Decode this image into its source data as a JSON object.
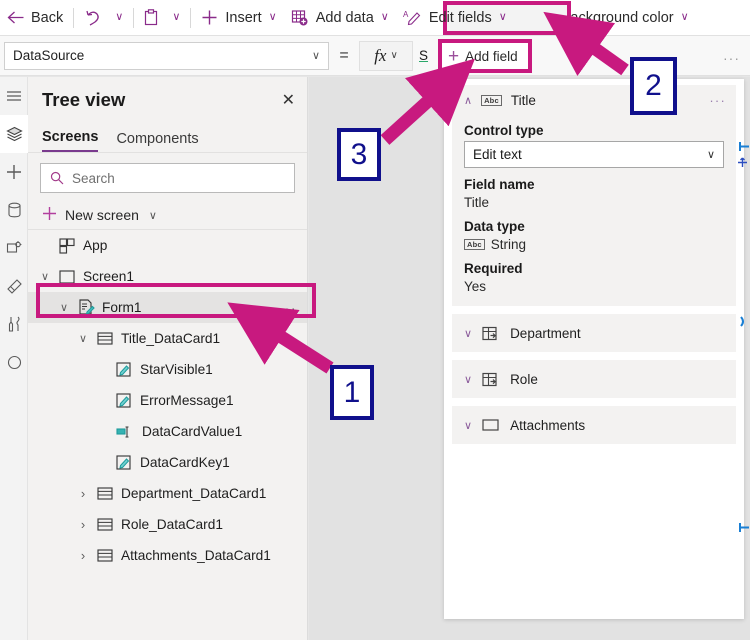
{
  "toolbar": {
    "back_label": "Back",
    "undo_icon": "undo-icon",
    "undo_chevron": "∨",
    "paste_icon": "paste-icon",
    "paste_chevron": "∨",
    "insert_label": "Insert",
    "insert_chevron": "∨",
    "add_data_label": "Add data",
    "add_data_chevron": "∨",
    "edit_fields_label": "Edit fields",
    "edit_fields_chevron": "∨",
    "background_color_label": "Background color",
    "background_color_chevron": "∨"
  },
  "formula_bar": {
    "property_value": "DataSource",
    "property_chevron": "∨",
    "equals": "=",
    "fx_label": "fx",
    "fx_chevron": "∨",
    "formula_text": "S",
    "overflow_dots": "···",
    "add_field_label": "Add field",
    "add_field_plus": "+"
  },
  "tree_view": {
    "title": "Tree view",
    "close_label": "✕",
    "tabs": [
      {
        "label": "Screens",
        "selected": true
      },
      {
        "label": "Components",
        "selected": false
      }
    ],
    "search_placeholder": "Search",
    "new_screen_label": "New screen",
    "new_screen_chevron": "∨",
    "nodes": [
      {
        "label": "App",
        "indent": 0,
        "twisty": "",
        "icon": "app-icon",
        "selected": false,
        "dots": false
      },
      {
        "label": "Screen1",
        "indent": 0,
        "twisty": "∨",
        "icon": "screen-icon",
        "selected": false,
        "dots": false
      },
      {
        "label": "Form1",
        "indent": 1,
        "twisty": "∨",
        "icon": "form-icon",
        "selected": true,
        "dots": true
      },
      {
        "label": "Title_DataCard1",
        "indent": 2,
        "twisty": "∨",
        "icon": "datacard-icon",
        "selected": false,
        "dots": false
      },
      {
        "label": "StarVisible1",
        "indent": 3,
        "twisty": "",
        "icon": "label-icon",
        "selected": false,
        "dots": false
      },
      {
        "label": "ErrorMessage1",
        "indent": 3,
        "twisty": "",
        "icon": "label-icon",
        "selected": false,
        "dots": false
      },
      {
        "label": "DataCardValue1",
        "indent": 3,
        "twisty": "",
        "icon": "textinput-icon",
        "selected": false,
        "dots": false
      },
      {
        "label": "DataCardKey1",
        "indent": 3,
        "twisty": "",
        "icon": "label-icon",
        "selected": false,
        "dots": false
      },
      {
        "label": "Department_DataCard1",
        "indent": 2,
        "twisty": "≥",
        "icon": "datacard-icon",
        "selected": false,
        "dots": false
      },
      {
        "label": "Role_DataCard1",
        "indent": 2,
        "twisty": "≥",
        "icon": "datacard-icon",
        "selected": false,
        "dots": false
      },
      {
        "label": "Attachments_DataCard1",
        "indent": 2,
        "twisty": "≥",
        "icon": "datacard-icon",
        "selected": false,
        "dots": false
      }
    ]
  },
  "rail": {
    "items": [
      {
        "name": "menu-icon",
        "active": false
      },
      {
        "name": "tree-view-icon",
        "active": true
      },
      {
        "name": "insert-icon",
        "active": false
      },
      {
        "name": "data-icon",
        "active": false
      },
      {
        "name": "media-icon",
        "active": false
      },
      {
        "name": "theme-icon",
        "active": false
      },
      {
        "name": "tools-icon",
        "active": false
      },
      {
        "name": "more-icon",
        "active": false
      }
    ]
  },
  "fields_panel": {
    "expanded_field": {
      "name": "Title",
      "type_badge": "Abc",
      "caret": "∧",
      "dots": "···",
      "control_type_label": "Control type",
      "control_type_value": "Edit text",
      "control_type_chevron": "∨",
      "field_name_label": "Field name",
      "field_name_value": "Title",
      "data_type_label": "Data type",
      "data_type_badge": "Abc",
      "data_type_value": "String",
      "required_label": "Required",
      "required_value": "Yes"
    },
    "collapsed_fields": [
      {
        "name": "Department",
        "icon": "lookup-icon",
        "caret": "∨"
      },
      {
        "name": "Role",
        "icon": "lookup-icon",
        "caret": "∨"
      },
      {
        "name": "Attachments",
        "icon": "attachment-icon",
        "caret": "∨"
      }
    ]
  },
  "annotations": {
    "callouts": [
      {
        "number": "1",
        "points_to": "Form1 tree node"
      },
      {
        "number": "2",
        "points_to": "Edit fields toolbar button"
      },
      {
        "number": "3",
        "points_to": "Add field button"
      }
    ],
    "highlight_color": "#c8197f",
    "callout_color": "#10108c"
  }
}
